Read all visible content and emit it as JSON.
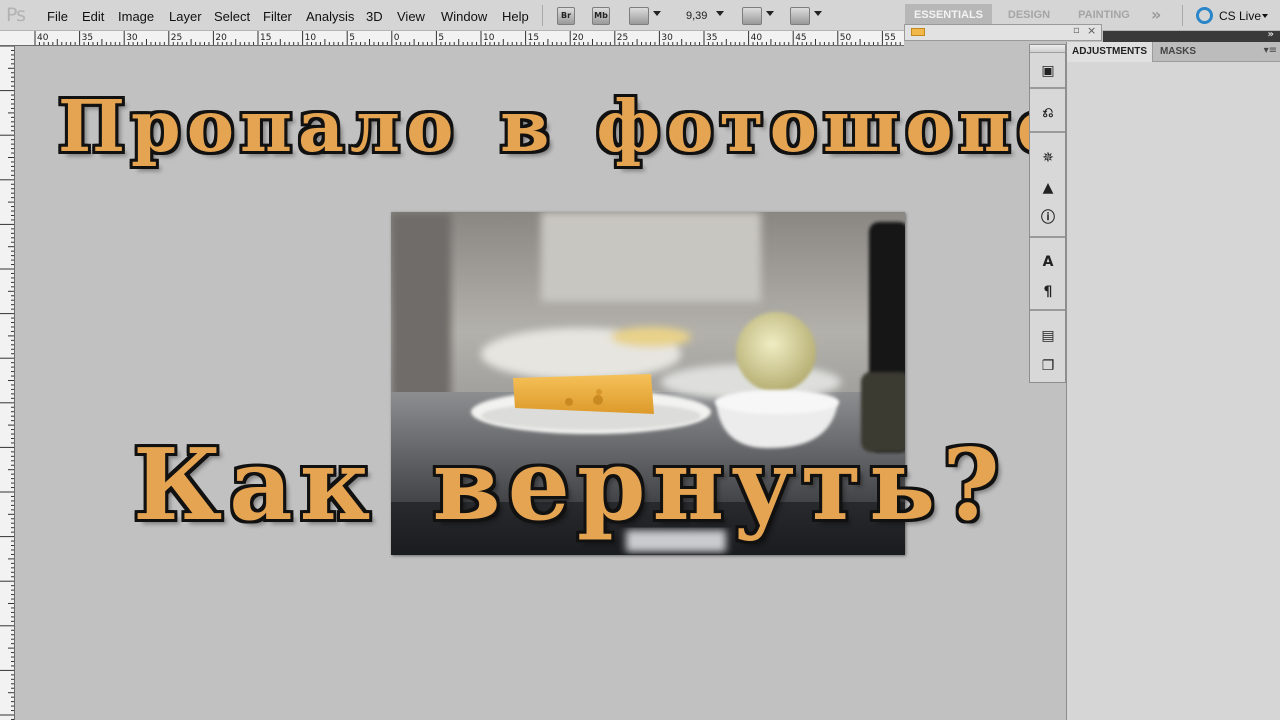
{
  "app": {
    "logo": "Ps"
  },
  "menu": [
    "File",
    "Edit",
    "Image",
    "Layer",
    "Select",
    "Filter",
    "Analysis",
    "3D",
    "View",
    "Window",
    "Help"
  ],
  "toolbar": {
    "bridge": "Br",
    "mini_bridge": "Mb",
    "zoom": "9,39"
  },
  "workspaces": {
    "essentials": "ESSENTIALS",
    "design": "DESIGN",
    "painting": "PAINTING",
    "more": "»"
  },
  "cs_live": {
    "label": "CS Live"
  },
  "ruler": {
    "h_labels": [
      "40",
      "35",
      "30",
      "25",
      "20",
      "15",
      "10",
      "5",
      "0",
      "5",
      "10",
      "15",
      "20",
      "25",
      "30",
      "35",
      "40",
      "45",
      "50",
      "55"
    ]
  },
  "canvas": {
    "title_top": "Пропало в фотошопе все!",
    "title_bottom": "Как вернуть?"
  },
  "panel": {
    "tabs": [
      "ADJUSTMENTS",
      "MASKS"
    ],
    "menu": "▾≡"
  },
  "dock": {
    "icons": [
      "mini-bridge-icon",
      "history-icon",
      "navigator-icon",
      "histogram-icon",
      "info-icon",
      "character-icon",
      "paragraph-icon",
      "layer-comps-icon",
      "clone-source-icon"
    ]
  },
  "colors": {
    "title_fill": "#e5a452",
    "title_outline": "#111111",
    "cs_live_accent": "#2a86c9"
  }
}
